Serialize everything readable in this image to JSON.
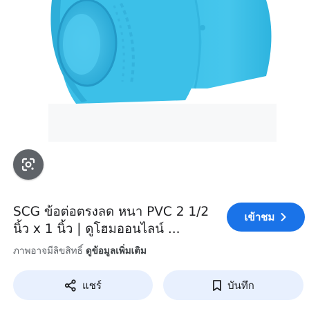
{
  "result": {
    "title": "SCG ข้อต่อตรงลด หนา PVC 2 1/2 นิ้ว x 1 นิ้ว | ดูโฮมออนไลน์ ...",
    "visit_label": "เข้าชม",
    "copyright_text": "ภาพอาจมีลิขสิทธิ์",
    "more_info_label": "ดูข้อมูลเพิ่มเติม"
  },
  "actions": {
    "share_label": "แชร์",
    "save_label": "บันทึก"
  },
  "icons": {
    "lens": "google-lens-icon",
    "visit_arrow": "chevron-right-icon",
    "share": "share-icon",
    "save": "bookmark-icon"
  },
  "colors": {
    "accent": "#1a73e8",
    "button_bg": "#e8f0fe",
    "pipe": "#3ec1e8"
  }
}
